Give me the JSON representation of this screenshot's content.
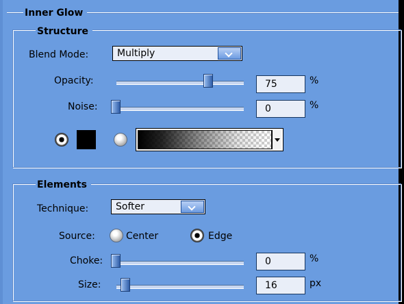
{
  "window": {
    "section_title": "Inner Glow"
  },
  "structure": {
    "title": "Structure",
    "blend_mode": {
      "label": "Blend Mode:",
      "value": "Multiply"
    },
    "opacity": {
      "label": "Opacity:",
      "value": "75",
      "unit": "%",
      "slider_fraction": 0.75
    },
    "noise": {
      "label": "Noise:",
      "value": "0",
      "unit": "%",
      "slider_fraction": 0.0
    },
    "fill_options": {
      "solid_selected": true,
      "gradient_selected": false,
      "solid_color": "#000000"
    }
  },
  "elements": {
    "title": "Elements",
    "technique": {
      "label": "Technique:",
      "value": "Softer"
    },
    "source": {
      "label": "Source:",
      "center_label": "Center",
      "edge_label": "Edge",
      "selected": "Edge"
    },
    "choke": {
      "label": "Choke:",
      "value": "0",
      "unit": "%",
      "slider_fraction": 0.0
    },
    "size": {
      "label": "Size:",
      "value": "16",
      "unit": "px",
      "slider_fraction": 0.08
    }
  },
  "colors": {
    "panel_bg": "#6a9ce0",
    "field_bg": "#e9eef8",
    "accent": "#2f5ea9"
  },
  "icons": {
    "dropdown": "chevron-down-icon",
    "radio_on": "radio-selected-icon",
    "radio_off": "radio-unselected-icon"
  }
}
